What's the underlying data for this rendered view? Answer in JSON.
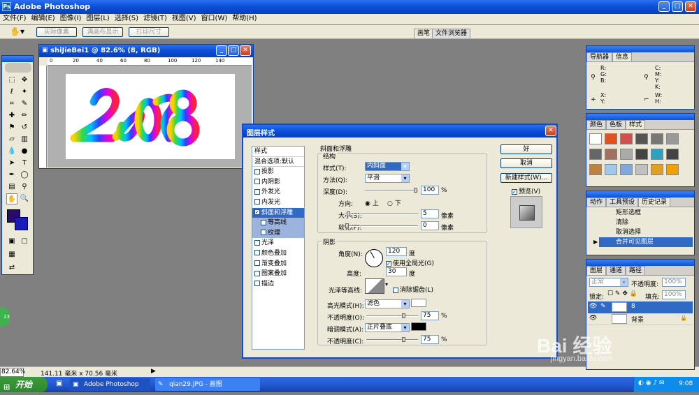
{
  "app": {
    "title": "Adobe Photoshop"
  },
  "menu": [
    "文件(F)",
    "编辑(E)",
    "图像(I)",
    "图层(L)",
    "选择(S)",
    "滤镜(T)",
    "视图(V)",
    "窗口(W)",
    "帮助(H)"
  ],
  "options": {
    "actual_pixels": "实际像素",
    "fit_screen": "满画布显示",
    "print_size": "打印尺寸",
    "tab_brushes": "画笔",
    "tab_browser": "文件浏览器"
  },
  "doc": {
    "title": "shiJieBei1 @ 82.6% (8, RGB)",
    "ruler": [
      "0",
      "20",
      "40",
      "60",
      "80",
      "100",
      "120",
      "140"
    ]
  },
  "status": {
    "zoom": "82.64%",
    "size": "141.11 毫米 x 70.56 毫米"
  },
  "dialog": {
    "title": "图层样式",
    "styles_header": "样式",
    "blend_options": "混合选项:默认",
    "styles": [
      {
        "label": "投影",
        "checked": false
      },
      {
        "label": "内阴影",
        "checked": false
      },
      {
        "label": "外发光",
        "checked": false
      },
      {
        "label": "内发光",
        "checked": false
      },
      {
        "label": "斜面和浮雕",
        "checked": true
      },
      {
        "label": "等高线",
        "checked": false
      },
      {
        "label": "纹理",
        "checked": false
      },
      {
        "label": "光泽",
        "checked": false
      },
      {
        "label": "颜色叠加",
        "checked": false
      },
      {
        "label": "渐变叠加",
        "checked": false
      },
      {
        "label": "图案叠加",
        "checked": false
      },
      {
        "label": "描边",
        "checked": false
      }
    ],
    "section_title": "斜面和浮雕",
    "structure": {
      "title": "结构",
      "style_label": "样式(T):",
      "style_value": "内斜面",
      "method_label": "方法(Q):",
      "method_value": "平滑",
      "depth_label": "深度(D):",
      "depth_value": "100",
      "depth_unit": "%",
      "depth_level": 1.0,
      "direction_label": "方向:",
      "dir_up": "上",
      "dir_down": "下",
      "size_label": "大小(S):",
      "size_value": "5",
      "size_unit": "像素",
      "size_level": 0.02,
      "soften_label": "软化(F):",
      "soften_value": "0",
      "soften_unit": "像素",
      "soften_level": 0.0
    },
    "shading": {
      "title": "阴影",
      "angle_label": "角度(N):",
      "angle_value": "120",
      "angle_unit": "度",
      "global_light": "使用全局光(G)",
      "altitude_label": "高度:",
      "altitude_value": "30",
      "altitude_unit": "度",
      "gloss_label": "光泽等高线:",
      "antialias": "消除锯齿(L)",
      "highlight_label": "高光模式(H):",
      "highlight_value": "滤色",
      "highlight_color": "#ffffff",
      "opacity1_label": "不透明度(O):",
      "opacity1_value": "75",
      "opacity1_unit": "%",
      "opacity1_level": 0.75,
      "shadow_label": "暗调模式(A):",
      "shadow_value": "正片叠底",
      "shadow_color": "#000000",
      "opacity2_label": "不透明度(C):",
      "opacity2_value": "75",
      "opacity2_unit": "%",
      "opacity2_level": 0.75
    },
    "buttons": {
      "ok": "好",
      "cancel": "取消",
      "new_style": "新建样式(W)...",
      "preview": "预览(V)"
    }
  },
  "navigator": {
    "tabs": [
      "导航器",
      "信息"
    ],
    "rgb": "R:\nG:\nB:",
    "cmyk": "C:\nM:\nY:\nK:",
    "xy": "X:\nY:",
    "wh": "W:\nH:"
  },
  "swatches": {
    "tabs": [
      "颜色",
      "色板",
      "样式"
    ]
  },
  "history": {
    "tabs": [
      "动作",
      "工具预设",
      "历史记录"
    ],
    "items": [
      "矩形选框",
      "清除",
      "取消选择",
      "合并可见图层"
    ]
  },
  "layers": {
    "tabs": [
      "图层",
      "通道",
      "路径"
    ],
    "blend": "正常",
    "opacity_label": "不透明度:",
    "opacity_value": "100%",
    "lock_label": "锁定:",
    "fill_label": "填充:",
    "fill_value": "100%",
    "items": [
      {
        "name": "8",
        "selected": true
      },
      {
        "name": "背景",
        "selected": false
      }
    ]
  },
  "taskbar": {
    "start": "开始",
    "items": [
      "Adobe Photoshop",
      "qian29.JPG - 画图"
    ],
    "time": "9:08"
  },
  "watermark": {
    "brand": "Bai 经验",
    "url": "jingyan.baidu.com"
  },
  "colors": {
    "fg": "#2a0a6e",
    "bg": "#1a1ab8",
    "accent": "#0a4ed8"
  }
}
